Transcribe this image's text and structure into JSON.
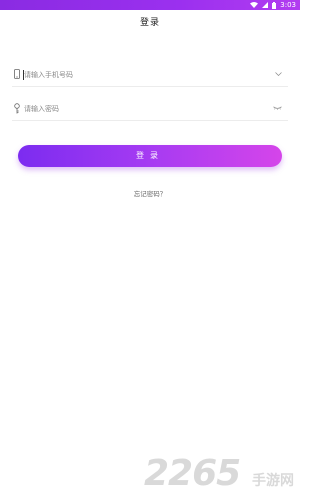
{
  "status_bar": {
    "time": "3:03",
    "icons": [
      "wifi-icon",
      "signal-icon",
      "battery-icon"
    ],
    "color": "#9b30ef"
  },
  "header": {
    "title": "登录"
  },
  "form": {
    "phone": {
      "placeholder": "请输入手机号码",
      "value": "",
      "left_icon": "phone-icon",
      "right_icon": "chevron-down-icon"
    },
    "password": {
      "placeholder": "请输入密码",
      "value": "",
      "left_icon": "key-icon",
      "right_icon": "eye-closed-icon"
    }
  },
  "login_button": {
    "label": "登录",
    "gradient_start": "#7c2cf0",
    "gradient_end": "#d545ea"
  },
  "forgot_password": {
    "label": "忘记密码？"
  },
  "watermark": {
    "number": "2265",
    "text": "手游网"
  }
}
